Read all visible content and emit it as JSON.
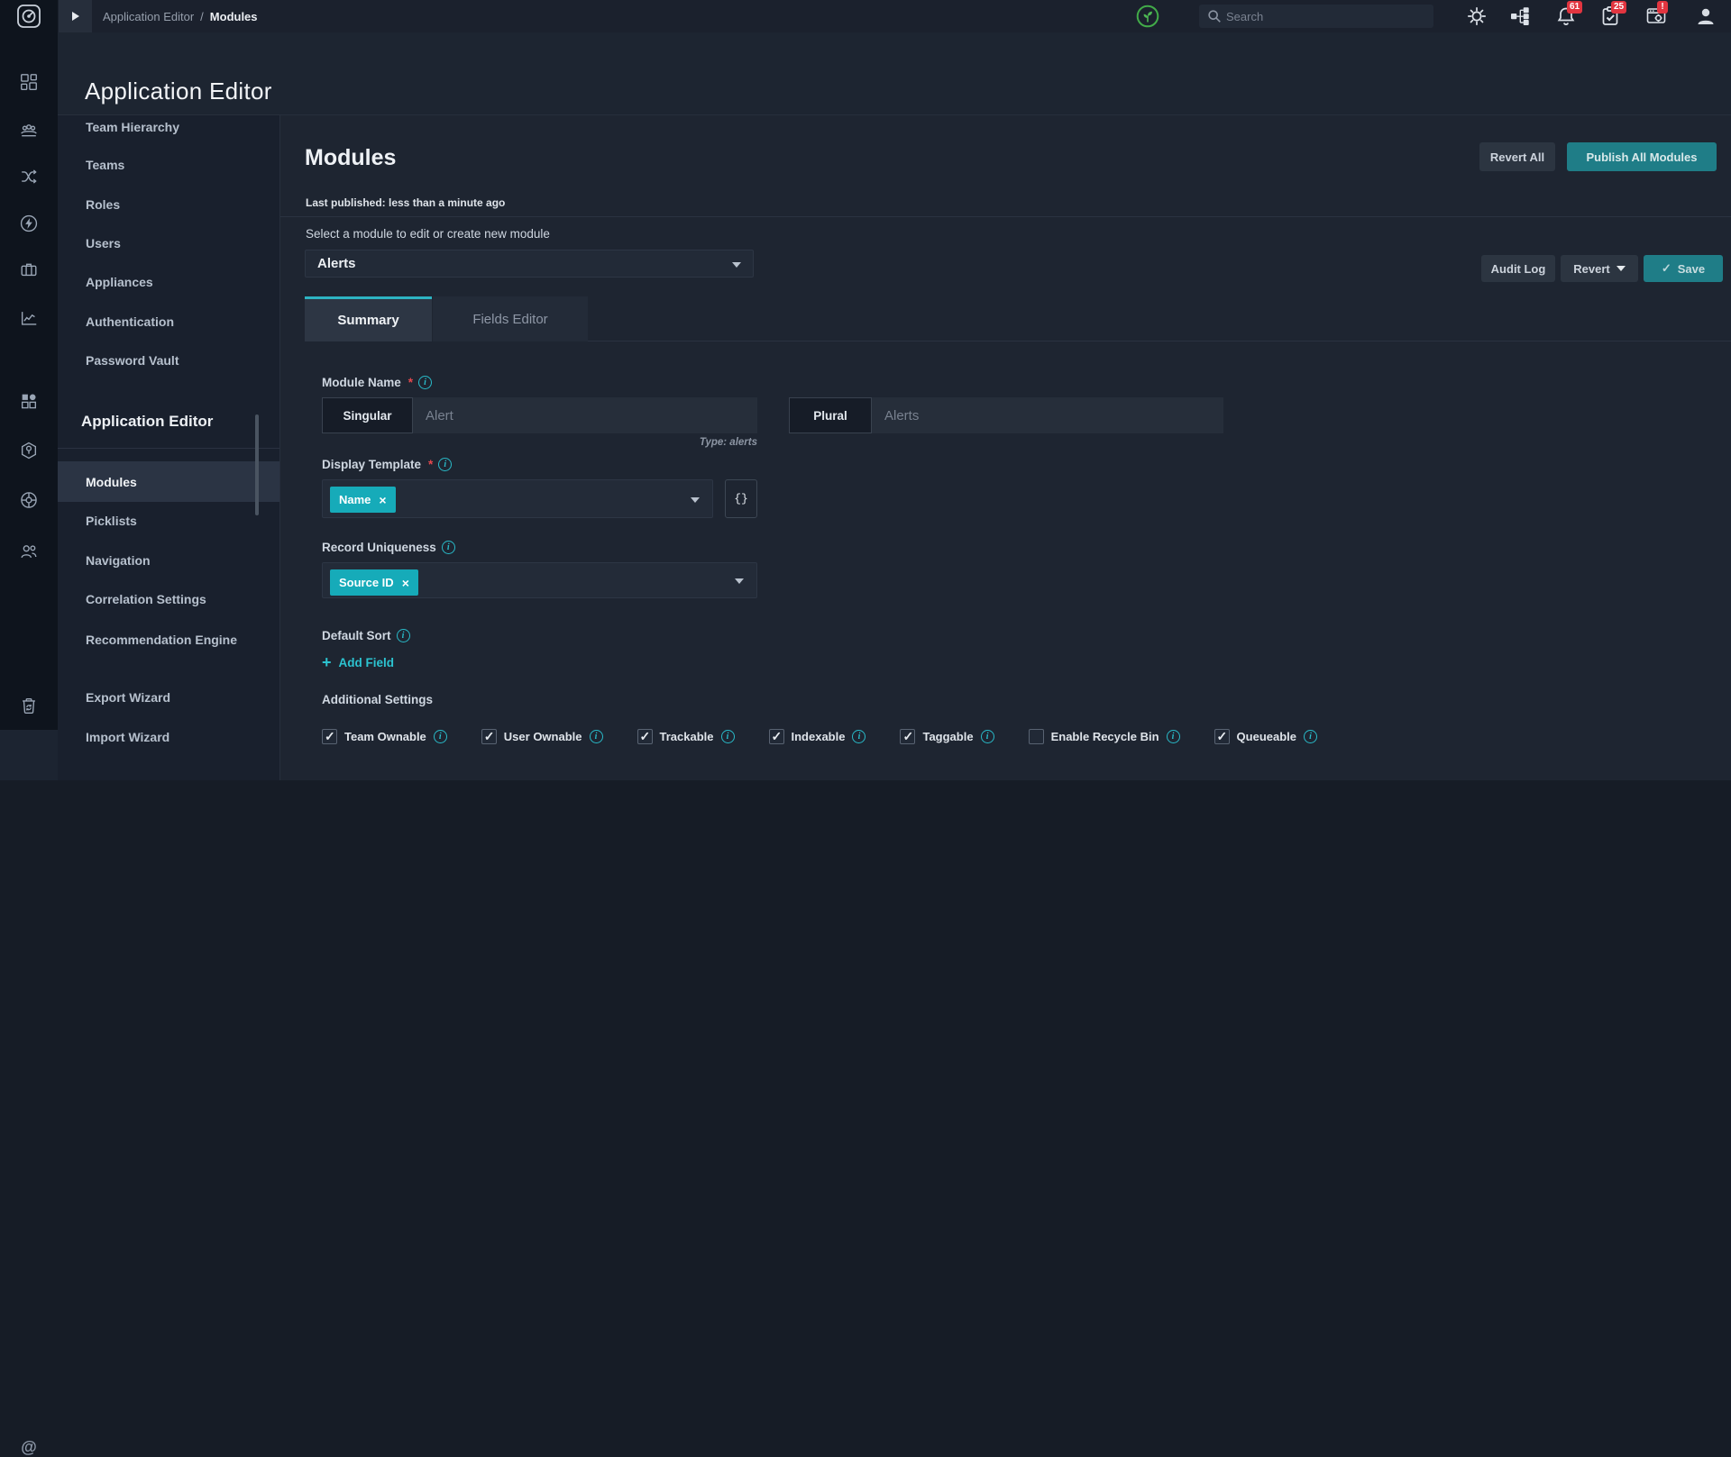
{
  "topbar": {
    "breadcrumb": {
      "section": "Application Editor",
      "separator": "/",
      "page": "Modules"
    },
    "search_placeholder": "Search",
    "notifications_badge": "61",
    "approvals_badge": "25",
    "system_badge": "!"
  },
  "page_title": "Application Editor",
  "sidebar": {
    "items": [
      {
        "label": "Team Hierarchy"
      },
      {
        "label": "Teams"
      },
      {
        "label": "Roles"
      },
      {
        "label": "Users"
      },
      {
        "label": "Appliances"
      },
      {
        "label": "Authentication"
      },
      {
        "label": "Password Vault"
      }
    ],
    "section_title": "Application Editor",
    "editor_items": [
      {
        "label": "Modules",
        "active": true
      },
      {
        "label": "Picklists",
        "active": false
      },
      {
        "label": "Navigation",
        "active": false
      },
      {
        "label": "Correlation Settings",
        "active": false
      },
      {
        "label": "Recommendation Engine",
        "active": false
      },
      {
        "label": "Export Wizard",
        "active": false
      },
      {
        "label": "Import Wizard",
        "active": false
      }
    ]
  },
  "main": {
    "title": "Modules",
    "last_published": "Last published: less than a minute ago",
    "revert_all_label": "Revert All",
    "publish_all_label": "Publish All Modules",
    "module_select_label": "Select a module to edit or create new module",
    "module_selected": "Alerts",
    "audit_log_label": "Audit Log",
    "revert_label": "Revert",
    "save_label": "Save",
    "save_check": "✓",
    "tabs": [
      {
        "label": "Summary",
        "active": true
      },
      {
        "label": "Fields Editor",
        "active": false
      }
    ],
    "form": {
      "module_name": {
        "label": "Module Name",
        "required_mark": "*",
        "singular_label": "Singular",
        "singular_value": "Alert",
        "plural_label": "Plural",
        "plural_value": "Alerts",
        "type_hint": "Type: alerts"
      },
      "display_template": {
        "label": "Display Template",
        "required_mark": "*",
        "chip": "Name",
        "chip_remove": "×",
        "json_button": "{}"
      },
      "record_uniqueness": {
        "label": "Record Uniqueness",
        "chip": "Source ID",
        "chip_remove": "×"
      },
      "default_sort": {
        "label": "Default Sort",
        "add_icon": "+",
        "add_field_label": "Add Field"
      },
      "additional_settings": {
        "label": "Additional Settings",
        "checkboxes": [
          {
            "label": "Team Ownable",
            "checked": true
          },
          {
            "label": "User Ownable",
            "checked": true
          },
          {
            "label": "Trackable",
            "checked": true
          },
          {
            "label": "Indexable",
            "checked": true
          },
          {
            "label": "Taggable",
            "checked": true
          },
          {
            "label": "Enable Recycle Bin",
            "checked": false
          },
          {
            "label": "Queueable",
            "checked": true
          }
        ]
      }
    }
  },
  "colors": {
    "accent_teal": "#2bb7c4",
    "button_teal": "#1f7d87",
    "chip_teal": "#16abb9",
    "badge_red": "#e23540",
    "health_green": "#42ab49"
  }
}
